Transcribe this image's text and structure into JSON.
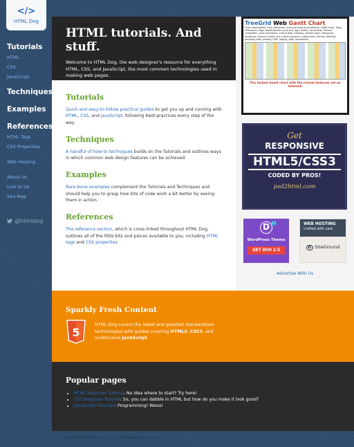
{
  "colors": {
    "brand_blue": "#2b6bb8",
    "green": "#66a22b",
    "orange": "#f08a00"
  },
  "logo": {
    "mark": "</>",
    "name": "HTML Dog"
  },
  "nav": [
    {
      "label": "Tutorials",
      "kind": "h",
      "top": 0
    },
    {
      "label": "HTML",
      "kind": "s"
    },
    {
      "label": "CSS",
      "kind": "s"
    },
    {
      "label": "JavaScript",
      "kind": "s"
    },
    {
      "label": "Techniques",
      "kind": "h"
    },
    {
      "label": "Examples",
      "kind": "h"
    },
    {
      "label": "References",
      "kind": "h"
    },
    {
      "label": "HTML Tags",
      "kind": "s"
    },
    {
      "label": "CSS Properties",
      "kind": "s"
    },
    {
      "label": "Web Hosting",
      "kind": "s"
    },
    {
      "label": "About Us",
      "kind": "s"
    },
    {
      "label": "Link to Us",
      "kind": "s"
    },
    {
      "label": "Site Map",
      "kind": "s"
    }
  ],
  "twitter": "@htmldog",
  "hero": {
    "title": "HTML tutorials. And stuff.",
    "intro": "Welcome to HTML Dog, the web designer's resource for everything HTML, CSS, and JavaScript, the most common technologies used in making web pages."
  },
  "sections": {
    "tutorials": {
      "title": "Tutorials",
      "link1": "Quick and easy-to-follow practical guides",
      "text1": " to get you up and running with ",
      "link2": "HTML",
      "sep1": ", ",
      "link3": "CSS",
      "sep2": ", and ",
      "link4": "JavaScript",
      "text2": ", following best-practices every step of the way."
    },
    "techniques": {
      "title": "Techniques",
      "link": "A handful of how-to techniques",
      "text": " builds on the Tutorials and outlines ways in which common web design features can be achieved."
    },
    "examples": {
      "title": "Examples",
      "link": "Bare-bone examples",
      "text": " complement the Tutorials and Techniques and should help you to grasp how bits of code work a bit better by seeing them in action."
    },
    "references": {
      "title": "References",
      "link1": "The reference section",
      "text1": ", which is cross-linked throughout HTML Dog, outlines all of the little bits and pieces available to you, including ",
      "link2": "HTML tags",
      "text2": " and ",
      "link3": "CSS properties",
      "text3": "."
    }
  },
  "ads": {
    "gantt": {
      "title_a": "TreeGrid",
      "title_b": " Web ",
      "title_c": "Gantt Chart",
      "desc": "Fully customizable, fully interactive, auto and manual scheduling, 1000s tasks. Tasks, milestones, flags, dependencies (ss,fs,sf,ff, lags, floats), constraints. Percent completion, price calculation, critical path, holidays, smooth zoom. Resources assigning, resource charts, any custom columns, custom bars. Sorting, filtering, grouping, tree, printing / PDF, paging, AJAX, localization.",
      "tagline": "The fastest Gantt chart with the richest features set on Internet!"
    },
    "psd": {
      "line1": "Get",
      "line2": "RESPONSIVE",
      "line3": "HTML5/CSS3",
      "line4": "CODED BY PROS!",
      "line5": "psd2html.com"
    },
    "divi": {
      "logo": "D",
      "version": "2.5",
      "title": "WordPress Theme",
      "button": "GET DIVI 2.5"
    },
    "siteground": {
      "title": "WEB HOSTING",
      "subtitle": "crafted with care",
      "brand": "SiteGround",
      "brand_icon": "G"
    },
    "advertise": "Advertise With Us"
  },
  "sparkly": {
    "title": "Sparkly Fresh Content",
    "text1": "HTML Dog covers the latest and greatest standardized technologies with guides covering ",
    "b1": "HTML5",
    "sep1": ", ",
    "b2": "CSS3",
    "text2": ", and unobtrusive ",
    "b3": "JavaScript",
    "text3": ".",
    "shield_label": "5"
  },
  "popular": {
    "title": "Popular pages",
    "items": [
      {
        "link": "HTML Beginner Tutorial",
        "text": ": No idea where to start? Try here!"
      },
      {
        "link": "CSS Beginner Tutorial",
        "text": ": So, you can dabble in HTML but how do you make it look good?"
      },
      {
        "link": "JavaScript Tutorials",
        "text": ": Programming! Wooo!"
      }
    ]
  },
  "footer": {
    "copy": "© 2003-2016. ",
    "terms": "Terms of use",
    "hosted": ". Hosted by ",
    "host": "SiteGround"
  }
}
